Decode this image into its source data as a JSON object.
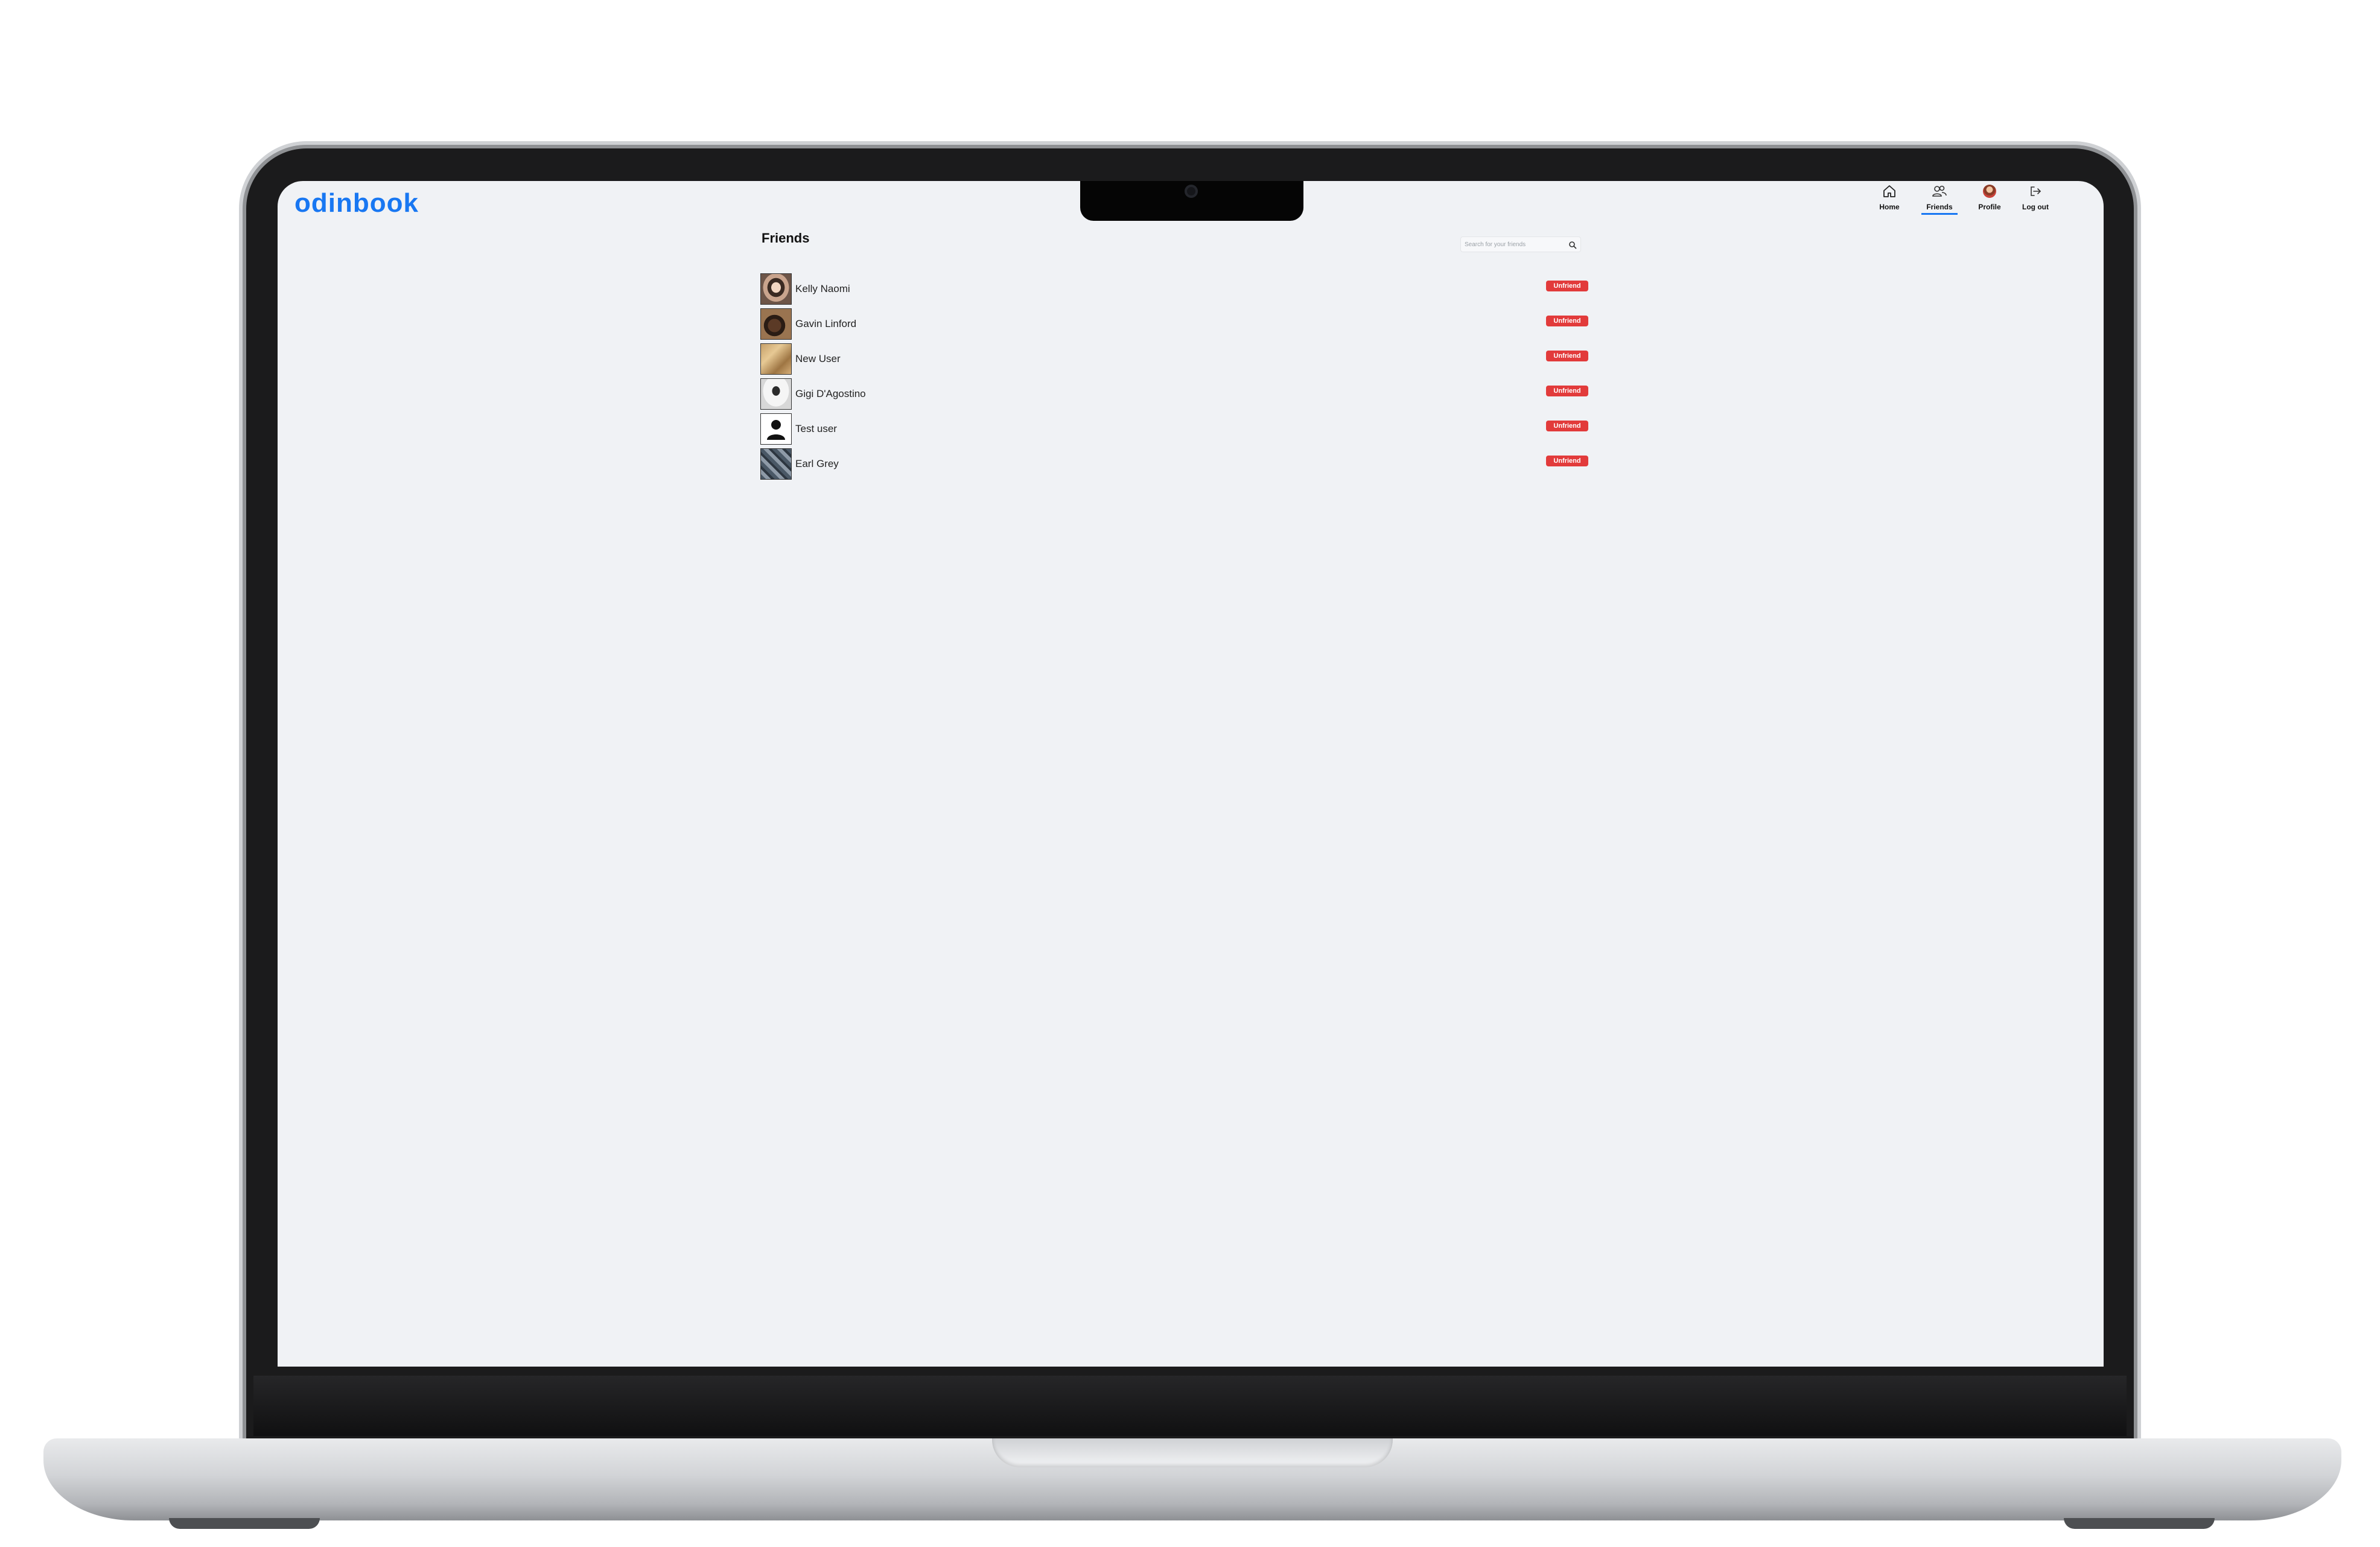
{
  "app": {
    "logo": "odinbook"
  },
  "nav": [
    {
      "label": "Home",
      "icon": "home-icon",
      "active": false
    },
    {
      "label": "Friends",
      "icon": "friends-icon",
      "active": true
    },
    {
      "label": "Profile",
      "icon": "profile-avatar",
      "active": false
    },
    {
      "label": "Log out",
      "icon": "logout-icon",
      "active": false
    }
  ],
  "page": {
    "title": "Friends",
    "search_placeholder": "Search for your friends"
  },
  "friends": [
    {
      "name": "Kelly Naomi",
      "action": "Unfriend"
    },
    {
      "name": "Gavin Linford",
      "action": "Unfriend"
    },
    {
      "name": "New User",
      "action": "Unfriend"
    },
    {
      "name": "Gigi D'Agostino",
      "action": "Unfriend"
    },
    {
      "name": "Test user",
      "action": "Unfriend"
    },
    {
      "name": "Earl Grey",
      "action": "Unfriend"
    }
  ],
  "colors": {
    "brand": "#1877f2",
    "danger": "#e23b3b",
    "background": "#f0f2f5"
  }
}
